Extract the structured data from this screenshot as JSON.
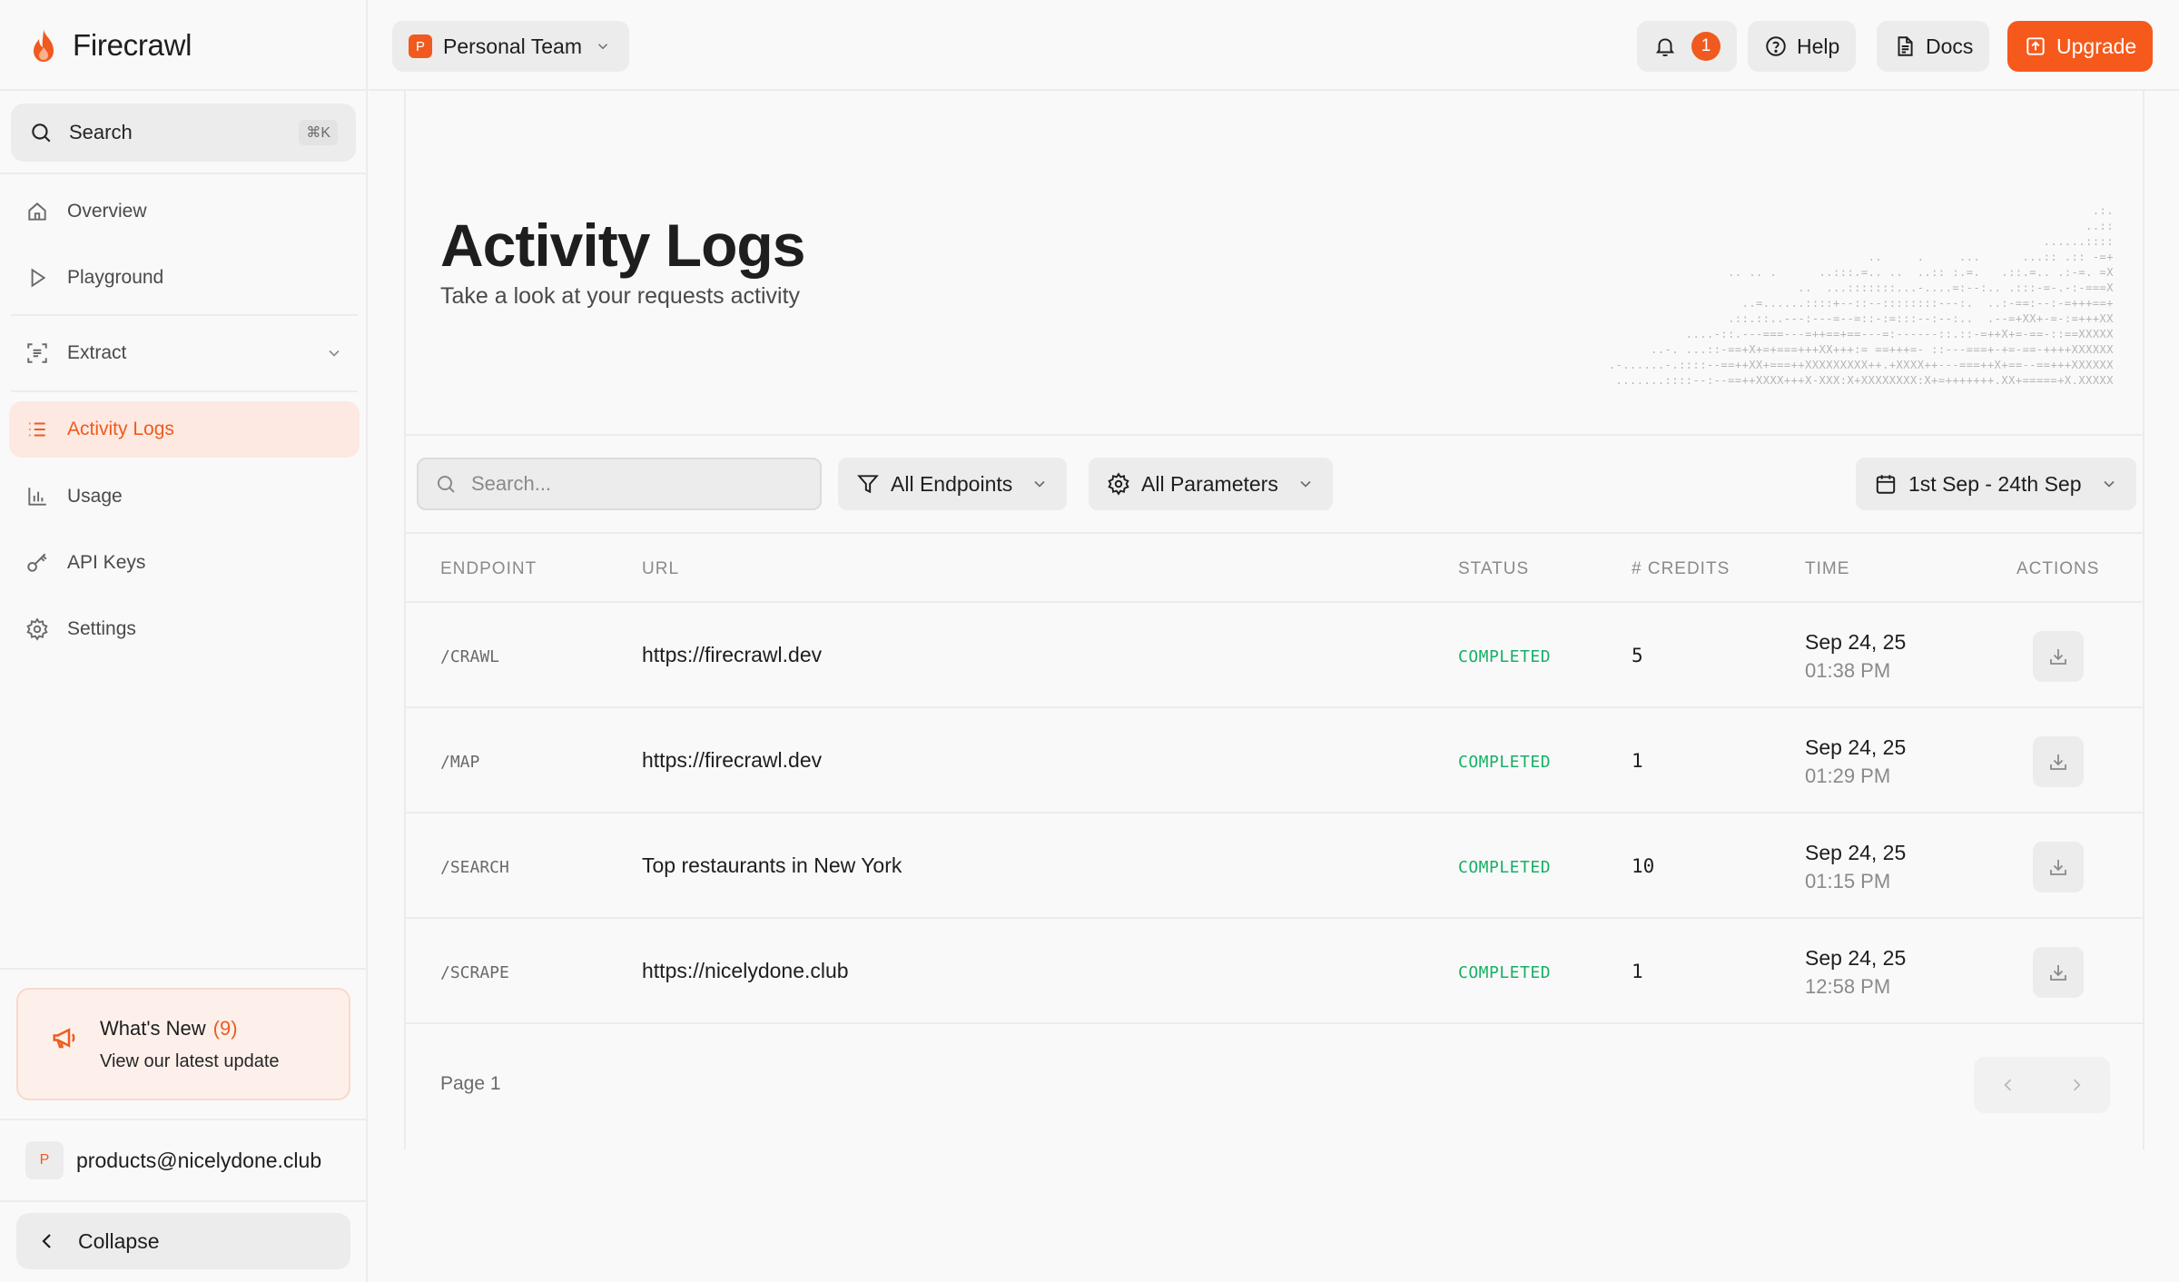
{
  "brand": {
    "name": "Firecrawl",
    "accent": "#f05a1e"
  },
  "sidebar": {
    "search": {
      "label": "Search",
      "shortcut": "⌘K"
    },
    "items": [
      {
        "label": "Overview",
        "icon": "home-icon"
      },
      {
        "label": "Playground",
        "icon": "play-icon"
      },
      {
        "label": "Extract",
        "icon": "extract-icon",
        "expandable": true
      },
      {
        "label": "Activity Logs",
        "icon": "list-icon",
        "active": true
      },
      {
        "label": "Usage",
        "icon": "bar-chart-icon"
      },
      {
        "label": "API Keys",
        "icon": "key-icon"
      },
      {
        "label": "Settings",
        "icon": "gear-icon"
      }
    ],
    "whats_new": {
      "title": "What's New",
      "count": "(9)",
      "subtitle": "View our latest update"
    },
    "account": {
      "initial": "P",
      "email": "products@nicelydone.club"
    },
    "collapse_label": "Collapse"
  },
  "topbar": {
    "team": {
      "initial": "P",
      "name": "Personal Team"
    },
    "notifications": {
      "count": "1"
    },
    "help_label": "Help",
    "docs_label": "Docs",
    "upgrade_label": "Upgrade"
  },
  "page": {
    "title": "Activity Logs",
    "subtitle": "Take a look at your requests activity"
  },
  "filters": {
    "search_placeholder": "Search...",
    "endpoints_label": "All Endpoints",
    "parameters_label": "All Parameters",
    "date_range_label": "1st Sep - 24th Sep"
  },
  "table": {
    "headers": {
      "endpoint": "ENDPOINT",
      "url": "URL",
      "status": "STATUS",
      "credits": "# CREDITS",
      "time": "TIME",
      "actions": "ACTIONS"
    },
    "rows": [
      {
        "endpoint": "/CRAWL",
        "url": "https://firecrawl.dev",
        "status": "COMPLETED",
        "credits": "5",
        "date": "Sep 24, 25",
        "time": "01:38 PM"
      },
      {
        "endpoint": "/MAP",
        "url": "https://firecrawl.dev",
        "status": "COMPLETED",
        "credits": "1",
        "date": "Sep 24, 25",
        "time": "01:29 PM"
      },
      {
        "endpoint": "/SEARCH",
        "url": "Top restaurants in New York",
        "status": "COMPLETED",
        "credits": "10",
        "date": "Sep 24, 25",
        "time": "01:15 PM"
      },
      {
        "endpoint": "/SCRAPE",
        "url": "https://nicelydone.club",
        "status": "COMPLETED",
        "credits": "1",
        "date": "Sep 24, 25",
        "time": "12:58 PM"
      }
    ],
    "status_color": "#17b066"
  },
  "pagination": {
    "label": "Page 1"
  }
}
